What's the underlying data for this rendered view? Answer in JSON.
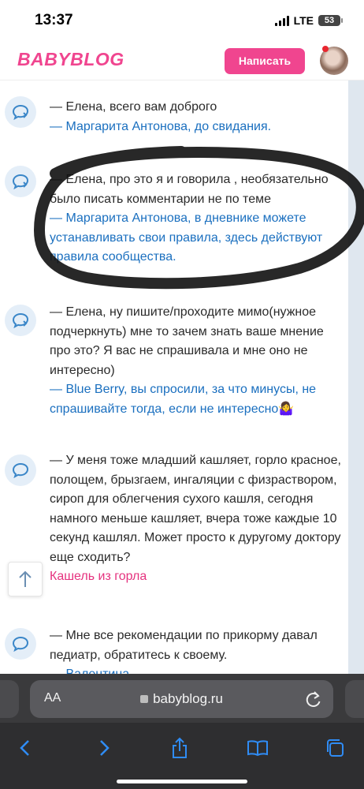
{
  "status_bar": {
    "time": "13:37",
    "network": "LTE",
    "battery": "53"
  },
  "header": {
    "logo": "BABYBLOG",
    "write_button": "Написать"
  },
  "comments": [
    {
      "text_lines": [
        "— Елена, всего вам доброго"
      ],
      "quote_lines": [
        "— Маргарита Антонова, до свидания."
      ],
      "source": ""
    },
    {
      "text_lines": [
        "— Елена, про это я и говорила , необязательно",
        "было писать комментарии не по теме"
      ],
      "quote_lines": [
        "— Маргарита Антонова, в дневнике можете",
        "устанавливать свои правила, здесь действуют",
        "правила сообщества."
      ],
      "source": ""
    },
    {
      "text_lines": [
        "— Елена, ну пишите/проходите мимо(нужное",
        "подчеркнуть) мне то зачем знать ваше мнение",
        "про это? Я вас не спрашивала и мне оно не",
        "интересно)"
      ],
      "quote_lines": [
        "— Blue Berry, вы спросили, за что минусы, не",
        "спрашивайте тогда, если не интересно🤷‍♀️"
      ],
      "source": ""
    },
    {
      "text_lines": [
        "— У меня тоже младший кашляет, горло красное,",
        "полощем, брызгаем, ингаляции с физраствором,",
        "сироп для облегчения сухого кашля, сегодня",
        "намного меньше кашляет, вчера тоже каждые 10",
        "секунд кашлял. Может просто к дуругому доктору",
        "еще сходить?"
      ],
      "quote_lines": [],
      "source": "Кашель из горла"
    },
    {
      "text_lines": [
        "— Мне все рекомендации по прикорму давал",
        "педиатр, обратитесь к своему."
      ],
      "quote_lines": [
        "— Валентина..."
      ],
      "source": ""
    }
  ],
  "browser": {
    "text_size_label": "AA",
    "url": "babyblog.ru"
  },
  "icons": {
    "comment_reply": "comment-reply-icon",
    "comment": "comment-icon",
    "scroll_top": "arrow-up-icon",
    "lock": "lock-icon",
    "reload": "reload-icon",
    "back": "chevron-left-icon",
    "forward": "chevron-right-icon",
    "share": "share-icon",
    "bookmarks": "book-icon",
    "tabs": "tabs-icon"
  },
  "colors": {
    "brand_pink": "#f0458f",
    "link_blue": "#1a6fbf",
    "feed_bg": "#f2f6fa",
    "icon_bg": "#e4eef8",
    "icon_stroke": "#3a86c8",
    "browser_accent": "#2f8cf5"
  }
}
